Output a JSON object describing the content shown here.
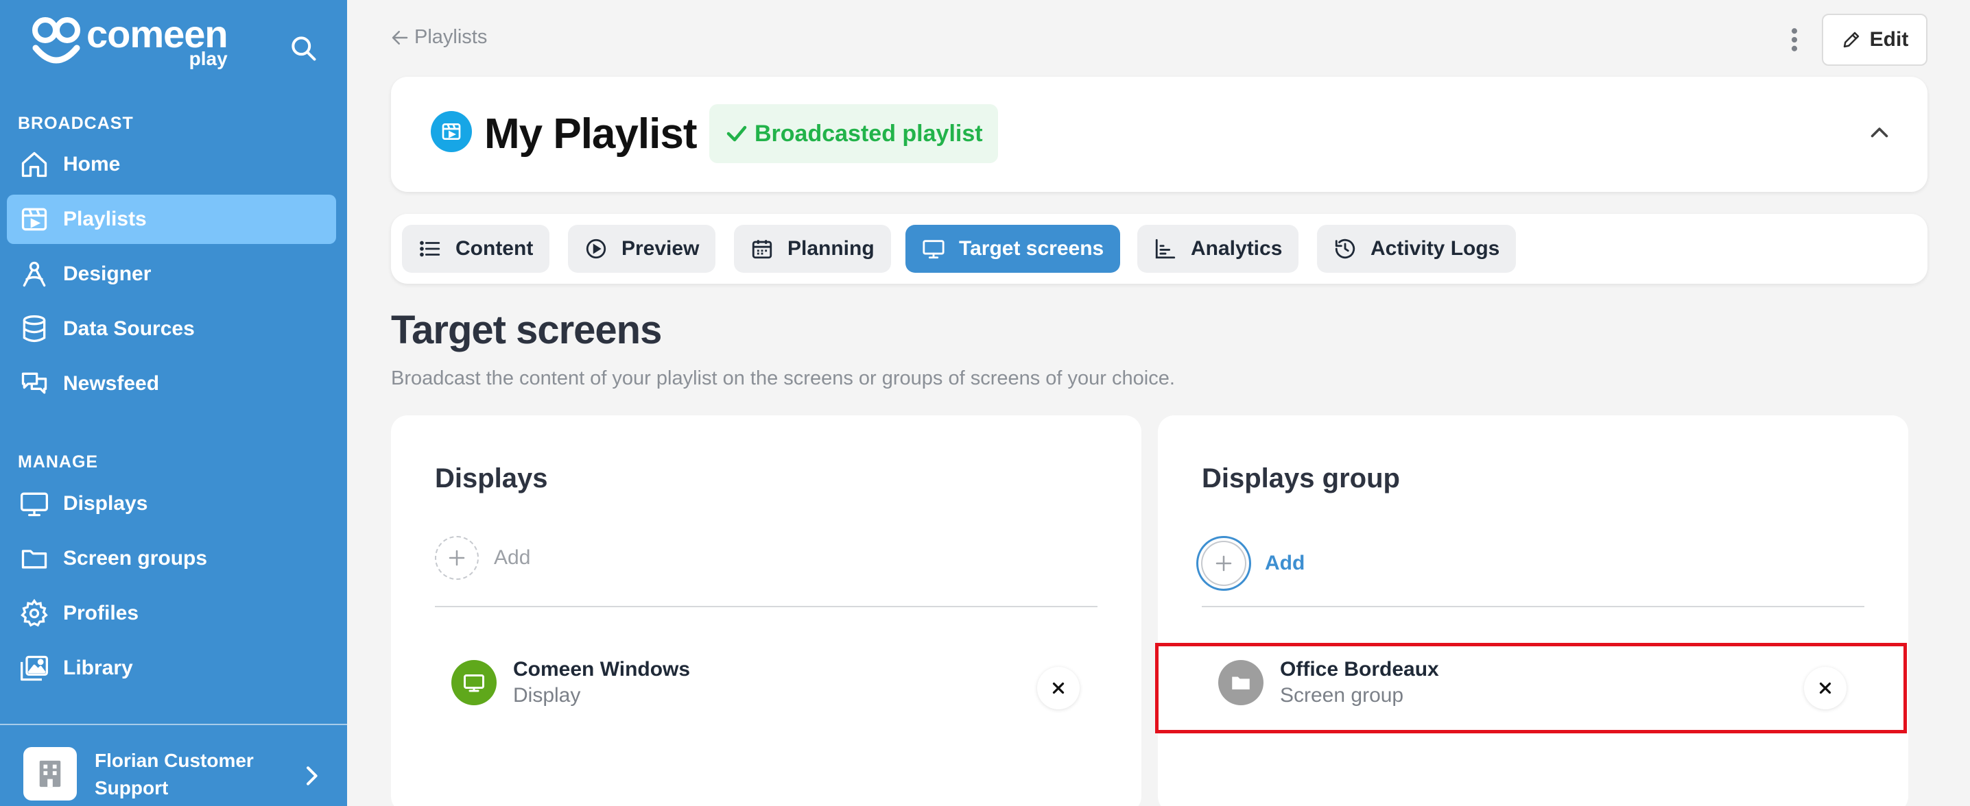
{
  "app": {
    "logo_word": "comeen",
    "logo_sub": "play"
  },
  "sidebar": {
    "broadcast_label": "BROADCAST",
    "manage_label": "MANAGE",
    "broadcast_items": [
      {
        "label": "Home",
        "icon": "home-icon"
      },
      {
        "label": "Playlists",
        "icon": "playlist-icon",
        "active": true
      },
      {
        "label": "Designer",
        "icon": "designer-icon"
      },
      {
        "label": "Data Sources",
        "icon": "database-icon"
      },
      {
        "label": "Newsfeed",
        "icon": "newsfeed-icon"
      }
    ],
    "manage_items": [
      {
        "label": "Displays",
        "icon": "monitor-icon"
      },
      {
        "label": "Screen groups",
        "icon": "folder-icon"
      },
      {
        "label": "Profiles",
        "icon": "gear-icon"
      },
      {
        "label": "Library",
        "icon": "library-icon"
      }
    ],
    "user": {
      "name": "Florian Customer Support"
    }
  },
  "topbar": {
    "back_label": "Playlists",
    "edit_label": "Edit"
  },
  "playlist": {
    "title": "My Playlist",
    "status": "Broadcasted playlist",
    "status_color": "#22b34a"
  },
  "tabs": [
    {
      "label": "Content",
      "icon": "list-icon"
    },
    {
      "label": "Preview",
      "icon": "play-icon"
    },
    {
      "label": "Planning",
      "icon": "calendar-icon"
    },
    {
      "label": "Target screens",
      "icon": "monitor-icon",
      "active": true
    },
    {
      "label": "Analytics",
      "icon": "chart-icon"
    },
    {
      "label": "Activity Logs",
      "icon": "history-icon"
    }
  ],
  "main": {
    "title": "Target screens",
    "description": "Broadcast the content of your playlist on the screens or groups of screens of your choice."
  },
  "displays_panel": {
    "title": "Displays",
    "add_label": "Add",
    "items": [
      {
        "name": "Comeen Windows",
        "type": "Display",
        "icon_color": "#5fa81b"
      }
    ]
  },
  "groups_panel": {
    "title": "Displays group",
    "add_label": "Add",
    "items": [
      {
        "name": "Office Bordeaux",
        "type": "Screen group",
        "icon_color": "#9e9e9e"
      }
    ]
  },
  "colors": {
    "sidebar_bg": "#3d8fd1",
    "active_nav": "#7cc4fa",
    "accent": "#3d8fd1",
    "highlight": "#e3101c"
  }
}
